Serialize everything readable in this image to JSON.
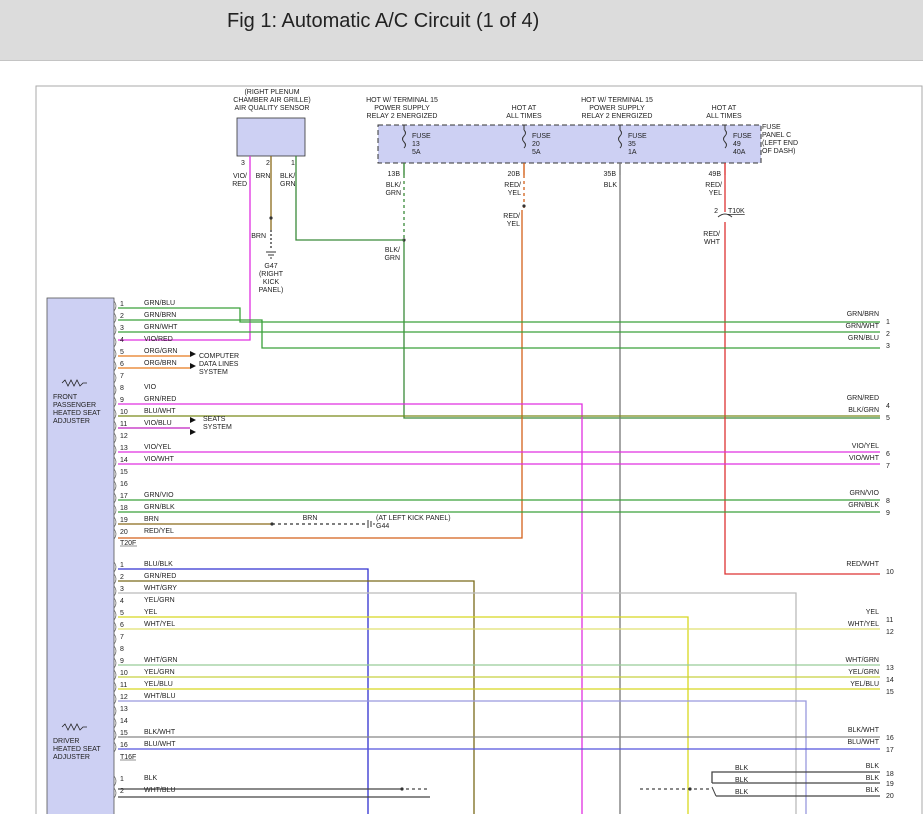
{
  "header": {
    "title": "Fig 1: Automatic A/C Circuit (1 of 4)"
  },
  "sensor": {
    "label_lines": [
      "(RIGHT PLENUM",
      "CHAMBER AIR GRILLE)",
      "AIR QUALITY SENSOR"
    ],
    "pins": [
      "3",
      "2",
      "1"
    ],
    "wire_vio_red": [
      "VIO/",
      "RED"
    ],
    "wire_brn": "BRN",
    "wire_blk_grn": [
      "BLK/",
      "GRN"
    ]
  },
  "ground_g47": {
    "wire": "BRN",
    "label_lines": [
      "G47",
      "(RIGHT",
      "KICK",
      "PANEL)"
    ]
  },
  "fuses": [
    {
      "hot": [
        "HOT W/ TERMINAL 15",
        "POWER SUPPLY",
        "RELAY 2 ENERGIZED"
      ],
      "fuse": [
        "FUSE",
        "13",
        "5A"
      ],
      "term": "13B",
      "wire": [
        "BLK/",
        "GRN"
      ],
      "color": "#3a8a3a"
    },
    {
      "hot": [
        "HOT AT",
        "ALL TIMES"
      ],
      "fuse": [
        "FUSE",
        "20",
        "5A"
      ],
      "term": "20B",
      "wire": [
        "RED/",
        "YEL"
      ],
      "color": "#d4601a"
    },
    {
      "hot": [
        "HOT W/ TERMINAL 15",
        "POWER SUPPLY",
        "RELAY 2 ENERGIZED"
      ],
      "fuse": [
        "FUSE",
        "35",
        "1A"
      ],
      "term": "35B",
      "wire": [
        "BLK"
      ],
      "color": "#777777"
    },
    {
      "hot": [
        "HOT AT",
        "ALL TIMES"
      ],
      "fuse": [
        "FUSE",
        "49",
        "40A"
      ],
      "term": "49B",
      "wire": [
        "RED/",
        "YEL"
      ],
      "color": "#dd3333"
    }
  ],
  "fuse_panel": [
    "FUSE",
    "PANEL C",
    "(LEFT END",
    "OF DASH)"
  ],
  "mid_labels": {
    "red_yel": [
      "RED/",
      "YEL"
    ],
    "blk_grn": [
      "BLK/",
      "GRN"
    ],
    "t10k_pin": "2",
    "t10k": "T10K",
    "red_wht": [
      "RED/",
      "WHT"
    ]
  },
  "component1": {
    "name_lines": [
      "FRONT",
      "PASSENGER",
      "HEATED SEAT",
      "ADJUSTER"
    ],
    "connector": "T20F",
    "pins": [
      {
        "n": "1",
        "wire": "GRN/BLU",
        "color": "#3aa03a"
      },
      {
        "n": "2",
        "wire": "GRN/BRN",
        "color": "#3aa03a"
      },
      {
        "n": "3",
        "wire": "GRN/WHT",
        "color": "#3aa03a"
      },
      {
        "n": "4",
        "wire": "VIO/RED",
        "color": "#e030e0"
      },
      {
        "n": "5",
        "wire": "ORG/GRN",
        "color": "#e87a1e"
      },
      {
        "n": "6",
        "wire": "ORG/BRN",
        "color": "#e87a1e"
      },
      {
        "n": "7",
        "wire": "",
        "color": ""
      },
      {
        "n": "8",
        "wire": "VIO",
        "color": ""
      },
      {
        "n": "9",
        "wire": "GRN/RED",
        "color": "#e030e0"
      },
      {
        "n": "10",
        "wire": "BLU/WHT",
        "color": "#7a8a1a"
      },
      {
        "n": "11",
        "wire": "VIO/BLU",
        "color": "#c020c0"
      },
      {
        "n": "12",
        "wire": "",
        "color": ""
      },
      {
        "n": "13",
        "wire": "VIO/YEL",
        "color": "#e030e0"
      },
      {
        "n": "14",
        "wire": "VIO/WHT",
        "color": "#e030e0"
      },
      {
        "n": "15",
        "wire": "",
        "color": ""
      },
      {
        "n": "16",
        "wire": "",
        "color": ""
      },
      {
        "n": "17",
        "wire": "GRN/VIO",
        "color": "#3aa03a"
      },
      {
        "n": "18",
        "wire": "GRN/BLK",
        "color": "#3aa03a"
      },
      {
        "n": "19",
        "wire": "BRN",
        "color": "#8a6a1a"
      },
      {
        "n": "20",
        "wire": "RED/YEL",
        "color": "#e8601e"
      }
    ],
    "computer_label": [
      "COMPUTER",
      "DATA LINES",
      "SYSTEM"
    ],
    "seats_label": [
      "SEATS",
      "SYSTEM"
    ],
    "g44_wire": "BRN",
    "g44_label": [
      "(AT LEFT KICK PANEL)",
      "G44"
    ]
  },
  "component2": {
    "name_lines": [
      "DRIVER",
      "HEATED SEAT",
      "ADJUSTER"
    ],
    "connector": "T16F",
    "pins": [
      {
        "n": "1",
        "wire": "BLU/BLK",
        "color": "#3030d0"
      },
      {
        "n": "2",
        "wire": "GRN/RED",
        "color": "#7a6a1a"
      },
      {
        "n": "3",
        "wire": "WHT/GRY",
        "color": "#bbbbbb"
      },
      {
        "n": "4",
        "wire": "YEL/GRN",
        "color": ""
      },
      {
        "n": "5",
        "wire": "YEL",
        "color": "#d8d820"
      },
      {
        "n": "6",
        "wire": "WHT/YEL",
        "color": "#e0e070"
      },
      {
        "n": "7",
        "wire": "",
        "color": ""
      },
      {
        "n": "8",
        "wire": "",
        "color": ""
      },
      {
        "n": "9",
        "wire": "WHT/GRN",
        "color": "#99cc99"
      },
      {
        "n": "10",
        "wire": "YEL/GRN",
        "color": "#c8d040"
      },
      {
        "n": "11",
        "wire": "YEL/BLU",
        "color": "#d8d820"
      },
      {
        "n": "12",
        "wire": "WHT/BLU",
        "color": "#9999dd"
      },
      {
        "n": "13",
        "wire": "",
        "color": ""
      },
      {
        "n": "14",
        "wire": "",
        "color": ""
      },
      {
        "n": "15",
        "wire": "BLK/WHT",
        "color": "#888888"
      },
      {
        "n": "16",
        "wire": "BLU/WHT",
        "color": "#5555dd"
      }
    ]
  },
  "component3": {
    "pins": [
      {
        "n": "1",
        "wire": "BLK",
        "color": "#444444"
      },
      {
        "n": "2",
        "wire": "WHT/BLU",
        "color": "#444444"
      }
    ]
  },
  "outputs": [
    {
      "label": "GRN/BRN",
      "num": "1",
      "color": "#3aa03a"
    },
    {
      "label": "GRN/WHT",
      "num": "2",
      "color": "#3aa03a"
    },
    {
      "label": "GRN/BLU",
      "num": "3",
      "color": "#3aa03a"
    },
    {
      "label": "GRN/RED",
      "num": "4",
      "color": "#7a8a1a"
    },
    {
      "label": "BLK/GRN",
      "num": "5",
      "color": "#3a8a3a"
    },
    {
      "label": "VIO/YEL",
      "num": "6",
      "color": "#e030e0"
    },
    {
      "label": "VIO/WHT",
      "num": "7",
      "color": "#e030e0"
    },
    {
      "label": "GRN/VIO",
      "num": "8",
      "color": "#3aa03a"
    },
    {
      "label": "GRN/BLK",
      "num": "9",
      "color": "#3aa03a"
    },
    {
      "label": "RED/WHT",
      "num": "10",
      "color": "#dd3333"
    },
    {
      "label": "YEL",
      "num": "11",
      "color": "#d8d820"
    },
    {
      "label": "WHT/YEL",
      "num": "12",
      "color": "#e0e070"
    },
    {
      "label": "WHT/GRN",
      "num": "13",
      "color": "#99cc99"
    },
    {
      "label": "YEL/GRN",
      "num": "14",
      "color": "#c8d040"
    },
    {
      "label": "YEL/BLU",
      "num": "15",
      "color": "#d8d820"
    },
    {
      "label": "BLK/WHT",
      "num": "16",
      "color": "#888888"
    },
    {
      "label": "BLU/WHT",
      "num": "17",
      "color": "#5555dd"
    },
    {
      "label": "BLK",
      "num": "18",
      "color": "#444444"
    },
    {
      "label": "BLK",
      "num": "19",
      "color": "#444444"
    },
    {
      "label": "BLK",
      "num": "20",
      "color": "#444444"
    }
  ],
  "blk_bus": [
    "BLK",
    "BLK",
    "BLK"
  ]
}
